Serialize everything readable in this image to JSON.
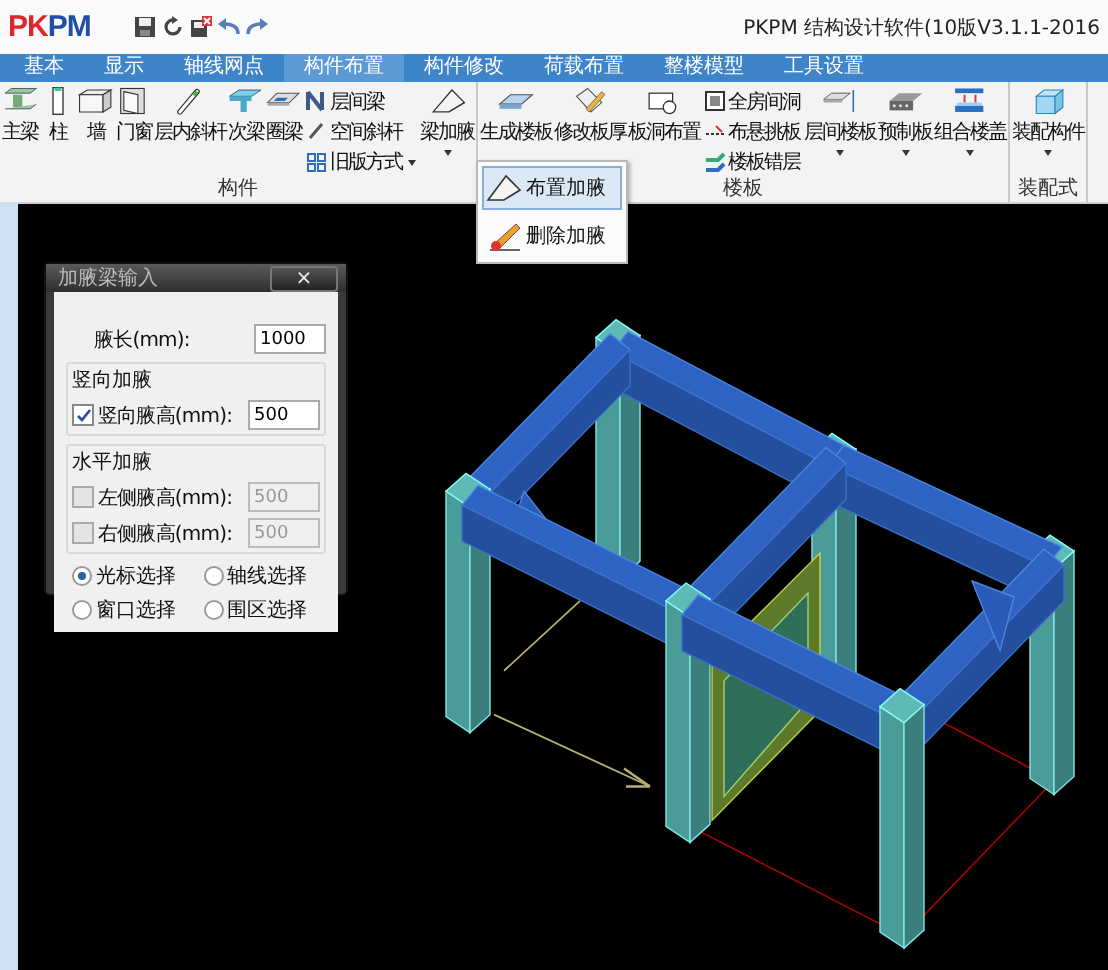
{
  "app": {
    "logo": "PKPM",
    "title": "PKPM 结构设计软件(10版V3.1.1-2016"
  },
  "tabs": [
    {
      "label": "基本",
      "selected": false
    },
    {
      "label": "显示",
      "selected": false
    },
    {
      "label": "轴线网点",
      "selected": false
    },
    {
      "label": "构件布置",
      "selected": true
    },
    {
      "label": "构件修改",
      "selected": false
    },
    {
      "label": "荷载布置",
      "selected": false
    },
    {
      "label": "整楼模型",
      "selected": false
    },
    {
      "label": "工具设置",
      "selected": false
    }
  ],
  "ribbon_groups": [
    {
      "label": "构件",
      "items": [
        {
          "kind": "large",
          "label": "主梁",
          "dropdown": false
        },
        {
          "kind": "large",
          "label": "柱",
          "dropdown": false
        },
        {
          "kind": "large",
          "label": "墙",
          "dropdown": false
        },
        {
          "kind": "large",
          "label": "门窗",
          "dropdown": false
        },
        {
          "kind": "large",
          "label": "层内斜杆",
          "dropdown": false
        },
        {
          "kind": "large",
          "label": "次梁",
          "dropdown": false
        },
        {
          "kind": "large",
          "label": "圈梁",
          "dropdown": false
        },
        {
          "kind": "stack",
          "entries": [
            {
              "label": "层间梁",
              "dropdown": false
            },
            {
              "label": "空间斜杆",
              "dropdown": false
            },
            {
              "label": "旧版方式",
              "dropdown": true
            }
          ]
        },
        {
          "kind": "large",
          "label": "梁加腋",
          "dropdown": true
        }
      ]
    },
    {
      "label": "楼板",
      "items": [
        {
          "kind": "large",
          "label": "生成楼板",
          "dropdown": false
        },
        {
          "kind": "large",
          "label": "修改板厚",
          "dropdown": false
        },
        {
          "kind": "large",
          "label": "板洞布置",
          "dropdown": false
        },
        {
          "kind": "stack",
          "entries": [
            {
              "label": "全房间洞",
              "dropdown": false
            },
            {
              "label": "布悬挑板",
              "dropdown": false
            },
            {
              "label": "楼板错层",
              "dropdown": false
            }
          ]
        },
        {
          "kind": "large",
          "label": "层间楼板",
          "dropdown": true
        },
        {
          "kind": "large",
          "label": "预制板",
          "dropdown": true
        },
        {
          "kind": "large",
          "label": "组合楼盖",
          "dropdown": true
        }
      ]
    },
    {
      "label": "装配式",
      "items": [
        {
          "kind": "large",
          "label": "装配构件",
          "dropdown": true
        }
      ]
    }
  ],
  "menu": {
    "items": [
      {
        "label": "布置加腋",
        "selected": true
      },
      {
        "label": "删除加腋",
        "selected": false
      }
    ]
  },
  "dialog": {
    "title": "加腋梁输入",
    "close": "×",
    "length": {
      "label": "腋长(mm):",
      "value": "1000"
    },
    "sections": [
      {
        "title": "竖向加腋",
        "rows": [
          {
            "label": "竖向腋高(mm):",
            "checked": true,
            "disabled": false,
            "value": "500"
          }
        ]
      },
      {
        "title": "水平加腋",
        "rows": [
          {
            "label": "左侧腋高(mm):",
            "checked": false,
            "disabled": true,
            "value": "500"
          },
          {
            "label": "右侧腋高(mm):",
            "checked": false,
            "disabled": true,
            "value": "500"
          }
        ]
      }
    ],
    "selection": [
      {
        "label": "光标选择",
        "selected": true
      },
      {
        "label": "轴线选择",
        "selected": false
      },
      {
        "label": "窗口选择",
        "selected": false
      },
      {
        "label": "围区选择",
        "selected": false
      }
    ]
  }
}
